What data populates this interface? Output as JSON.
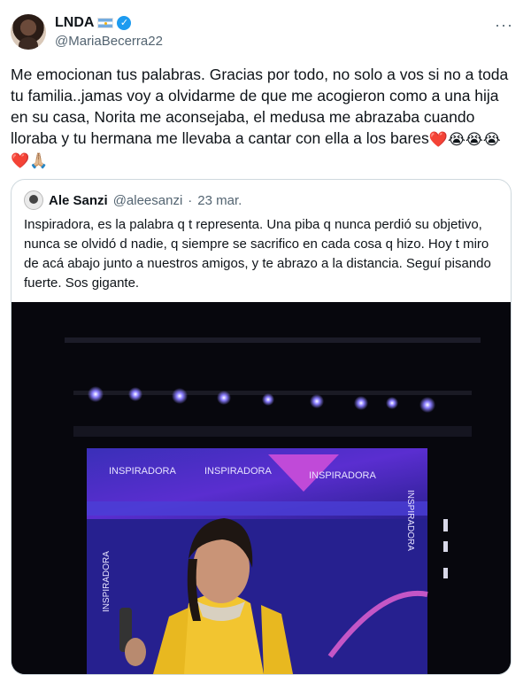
{
  "tweet": {
    "author": {
      "display_name": "LNDA",
      "handle": "@MariaBecerra22",
      "flag_icon": "argentina-flag-icon",
      "verified_icon": "verified-badge-icon"
    },
    "more_icon": "more-options-icon",
    "text": "Me emocionan tus palabras. Gracias por todo, no solo a vos si no a toda tu familia..jamas voy a olvidarme de que me acogieron como a una hija en su casa, Norita me aconsejaba, el medusa me abrazaba cuando lloraba y tu hermana me llevaba a cantar con ella a los bares",
    "emojis": [
      "❤️",
      "😭",
      "😭",
      "😭",
      "❤️",
      "🙏🏼"
    ]
  },
  "quoted_tweet": {
    "author": {
      "display_name": "Ale Sanzi",
      "handle": "@aleesanzi",
      "separator": "·",
      "date": "23 mar."
    },
    "text": "Inspiradora, es la palabra q t representa. Una piba q nunca perdió su objetivo, nunca se olvidó d nadie, q siempre se sacrifico en cada cosa q hizo. Hoy t miro de acá abajo junto a nuestros amigos, y te abrazo a la distancia. Seguí pisando fuerte. Sos gigante.",
    "media": {
      "screen_words": [
        "INSPIRADORA",
        "INSPIRADORA",
        "INSPIRADORA",
        "INSPIRADORA",
        "INSPIRADORA"
      ]
    }
  },
  "colors": {
    "text_primary": "#0f1419",
    "text_secondary": "#536471",
    "verified_blue": "#1d9bf0",
    "border": "#cfd9de",
    "heart_red": "#e0245e"
  }
}
